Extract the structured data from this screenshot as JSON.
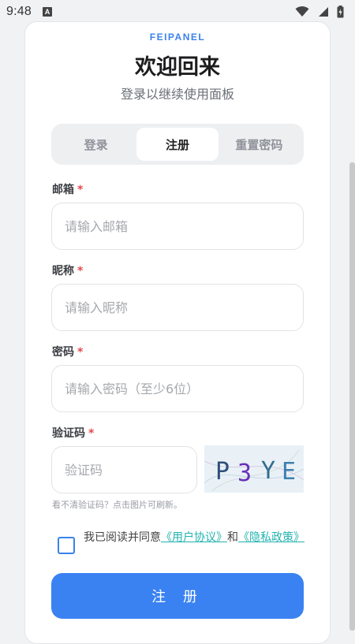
{
  "status_bar": {
    "time": "9:48",
    "notification_glyph": "A",
    "icons": [
      "wifi-icon",
      "signal-icon",
      "battery-charging-icon"
    ]
  },
  "brand": "FEIPANEL",
  "title": "欢迎回来",
  "subtitle": "登录以继续使用面板",
  "tabs": [
    {
      "label": "登录",
      "active": false
    },
    {
      "label": "注册",
      "active": true
    },
    {
      "label": "重置密码",
      "active": false
    }
  ],
  "form": {
    "required_mark": "*",
    "email": {
      "label": "邮箱",
      "placeholder": "请输入邮箱",
      "value": ""
    },
    "nickname": {
      "label": "昵称",
      "placeholder": "请输入昵称",
      "value": ""
    },
    "password": {
      "label": "密码",
      "placeholder": "请输入密码（至少6位）",
      "value": ""
    },
    "captcha": {
      "label": "验证码",
      "placeholder": "验证码",
      "value": "",
      "image_text": [
        "P",
        "3",
        "Y",
        "E"
      ],
      "hint": "看不清验证码？点击图片可刷新。"
    },
    "agreement": {
      "prefix": "我已阅读并同意",
      "user_agreement": "《用户协议》",
      "conjunction": "和",
      "privacy_policy": "《隐私政策》",
      "checked": false
    },
    "submit_label": "注 册"
  },
  "colors": {
    "accent": "#3a82f2",
    "brand": "#3a82ea",
    "link": "#22b3b0",
    "required": "#e5484d"
  }
}
